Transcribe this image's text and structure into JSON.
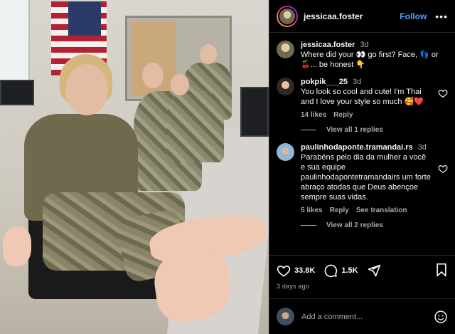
{
  "post": {
    "username": "jessicaa.foster",
    "follow_label": "Follow",
    "more_label": "•••"
  },
  "comments": [
    {
      "username": "jessicaa.foster",
      "time": "3d",
      "text": "Where did your 👀 go first? Face, 👣 or 🍒... be honest 👇"
    },
    {
      "username": "pokpik___25",
      "time": "3d",
      "text": "You look so cool and cute! I'm Thai and I love your style so much 🥰❤️",
      "likes": "14 likes",
      "reply": "Reply",
      "view_replies": "View all 1 replies"
    },
    {
      "username": "paulinhodaponte.tramandai.rs",
      "time": "3d",
      "text": "Parabéns pelo dia da mulher a você e sua equipe paulinhodapontetramandairs um forte abraço atodas que Deus abençoe sempre suas vidas.",
      "likes": "5 likes",
      "reply": "Reply",
      "translation": "See translation",
      "view_replies": "View all 2 replies"
    }
  ],
  "actions": {
    "likes_count": "33.8K",
    "comments_count": "1.5K",
    "time_ago": "3 days ago"
  },
  "add_comment": {
    "placeholder": "Add a comment..."
  },
  "icons": {
    "heart": "heart-icon",
    "comment": "comment-icon",
    "share": "share-icon",
    "save": "bookmark-icon",
    "emoji": "emoji-icon",
    "more": "more-icon"
  },
  "colors": {
    "follow": "#4aa3ff",
    "background": "#000000",
    "muted": "#a8a8a8"
  }
}
